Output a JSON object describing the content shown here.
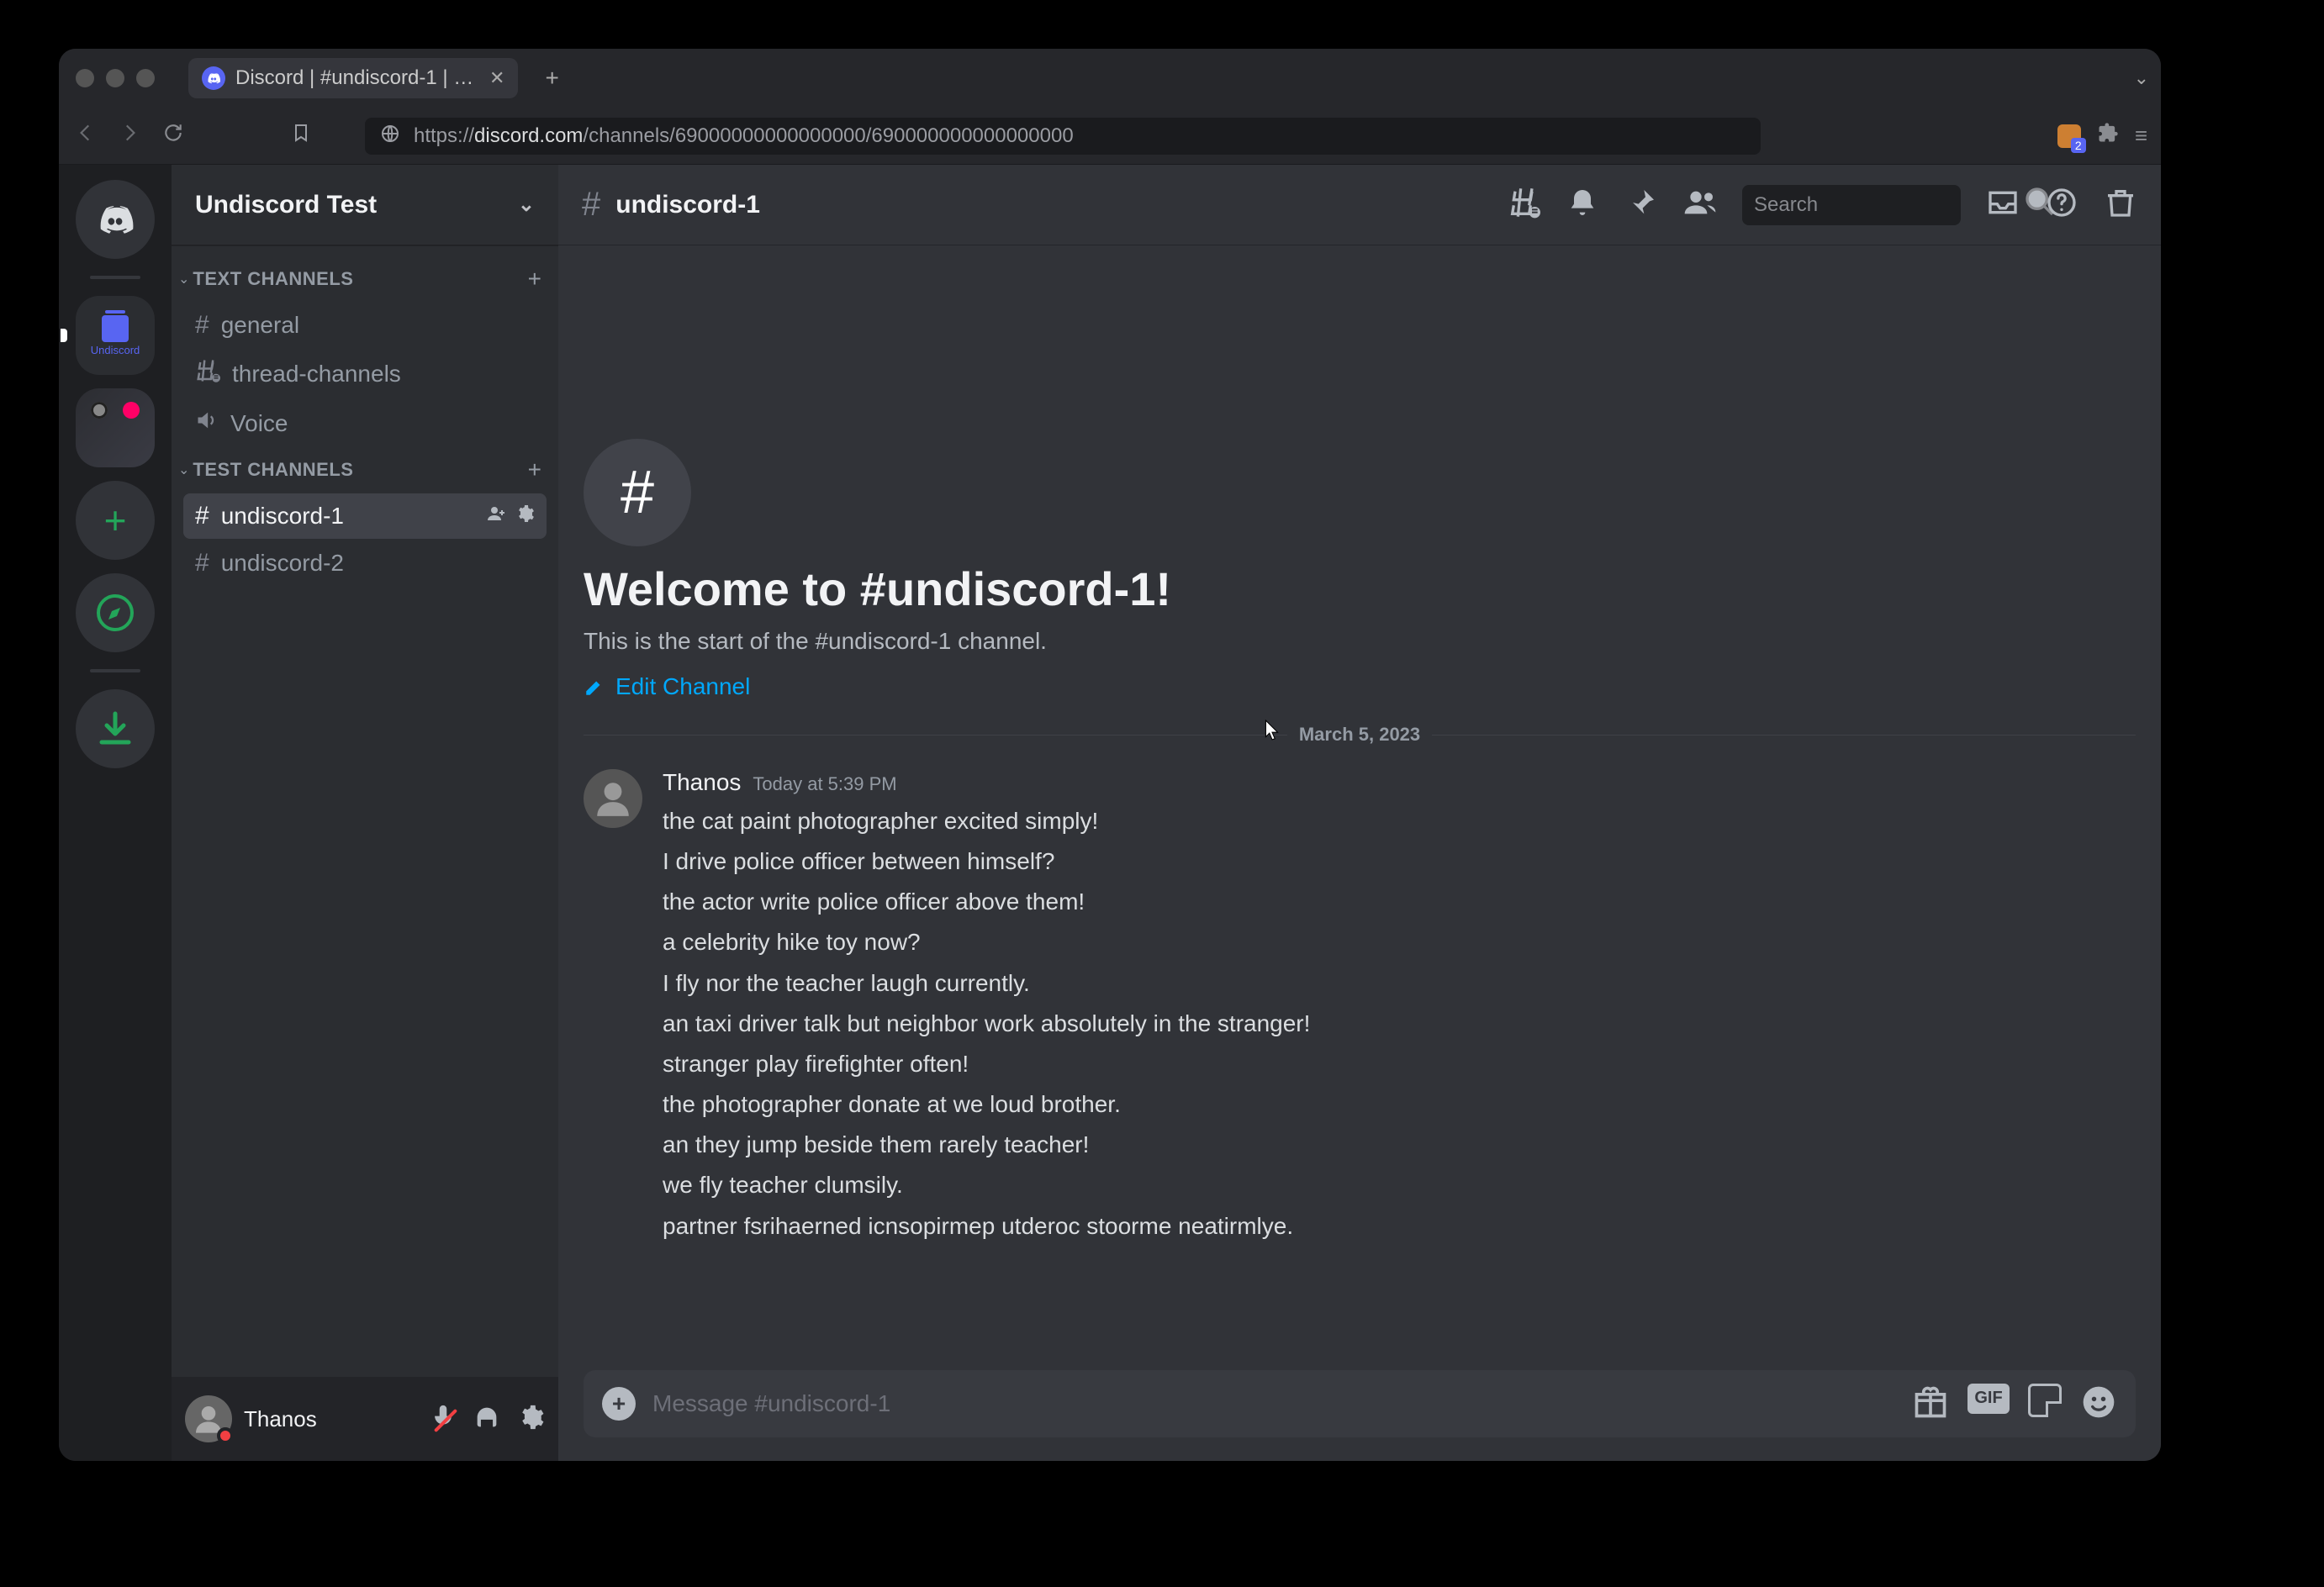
{
  "browser": {
    "tab_title": "Discord | #undiscord-1 | Undisc",
    "url_plain_prefix": "https://",
    "url_domain": "discord.com",
    "url_path": "/channels/69000000000000000/690000000000000000",
    "ext_badge": "2"
  },
  "server_name": "Undiscord Test",
  "categories": [
    {
      "name": "TEXT CHANNELS",
      "channels": [
        {
          "name": "general",
          "type": "text"
        },
        {
          "name": "thread-channels",
          "type": "thread"
        },
        {
          "name": "Voice",
          "type": "voice"
        }
      ]
    },
    {
      "name": "TEST CHANNELS",
      "channels": [
        {
          "name": "undiscord-1",
          "type": "text",
          "active": true
        },
        {
          "name": "undiscord-2",
          "type": "text"
        }
      ]
    }
  ],
  "user": {
    "name": "Thanos"
  },
  "channel_header": {
    "name": "undiscord-1",
    "search_placeholder": "Search"
  },
  "welcome": {
    "title": "Welcome to #undiscord-1!",
    "subtitle": "This is the start of the #undiscord-1 channel.",
    "edit": "Edit Channel"
  },
  "date_divider": "March 5, 2023",
  "message": {
    "author": "Thanos",
    "timestamp": "Today at 5:39 PM",
    "lines": [
      "the cat paint photographer excited simply!",
      "I drive police officer between himself?",
      "the actor write police officer above them!",
      "a celebrity hike toy now?",
      "I fly nor the teacher laugh currently.",
      "an taxi driver talk but neighbor work absolutely in the stranger!",
      "stranger play firefighter often!",
      "the photographer donate at we loud brother.",
      "an they jump beside them rarely teacher!",
      "we fly teacher clumsily.",
      "partner fsrihaerned  icnsopirmep utderoc stoorme neatirmlye."
    ]
  },
  "composer": {
    "placeholder": "Message #undiscord-1",
    "gif_label": "GIF"
  }
}
